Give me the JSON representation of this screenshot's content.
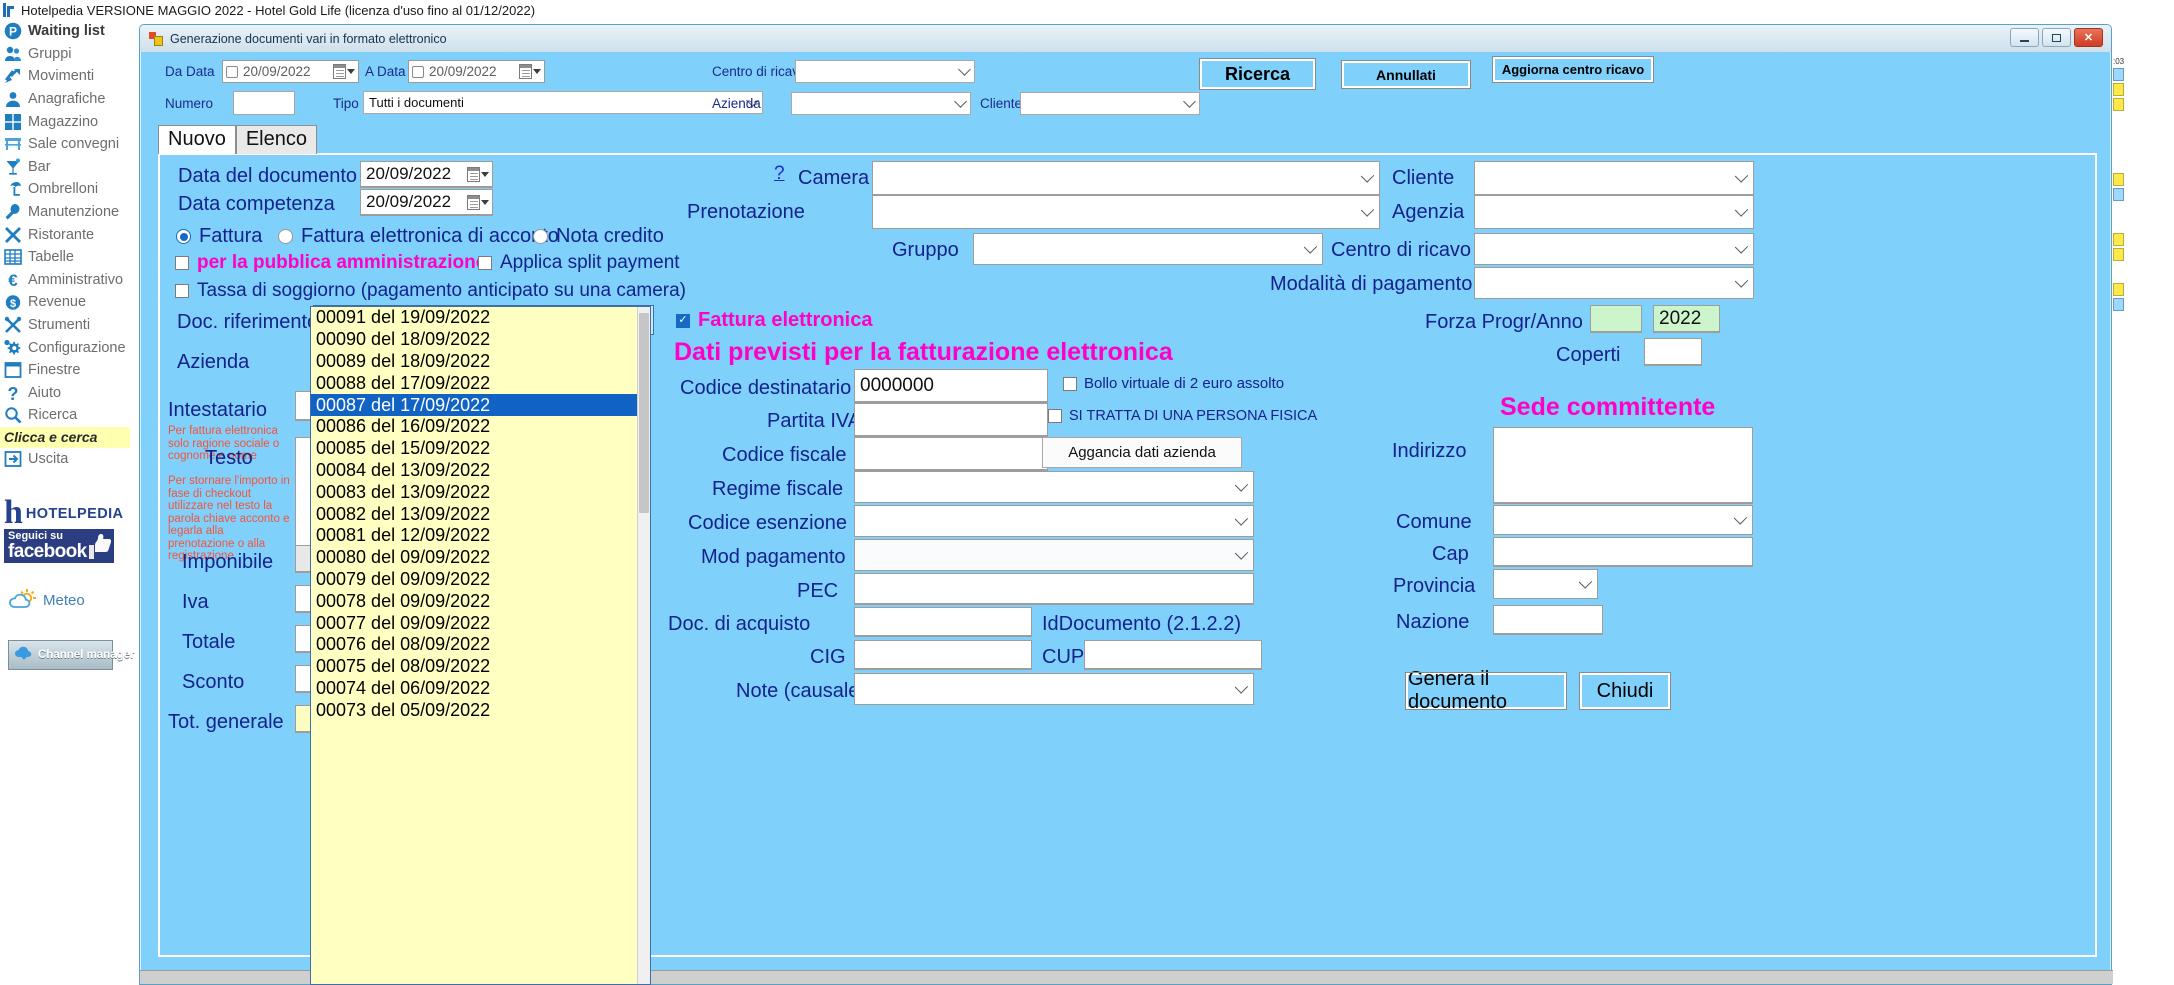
{
  "app": {
    "title": "Hotelpedia VERSIONE MAGGIO 2022 - Hotel Gold Life (licenza d'uso fino al 01/12/2022)",
    "logo_icon": "hotelpedia-logo-icon"
  },
  "sidebar": {
    "items": [
      {
        "label": "Waiting list",
        "icon": "parking-p-icon",
        "active": true
      },
      {
        "label": "Gruppi",
        "icon": "people-group-icon",
        "active": false
      },
      {
        "label": "Movimenti",
        "icon": "arrows-movement-icon",
        "active": false
      },
      {
        "label": "Anagrafiche",
        "icon": "person-card-icon",
        "active": false
      },
      {
        "label": "Magazzino",
        "icon": "boxes-warehouse-icon",
        "active": false
      },
      {
        "label": "Sale convegni",
        "icon": "conference-table-icon",
        "active": false
      },
      {
        "label": "Bar",
        "icon": "cocktail-glass-icon",
        "active": false
      },
      {
        "label": "Ombrelloni",
        "icon": "beach-umbrella-icon",
        "active": false
      },
      {
        "label": "Manutenzione",
        "icon": "wrench-icon",
        "active": false
      },
      {
        "label": "Ristorante",
        "icon": "fork-knife-icon",
        "active": false
      },
      {
        "label": "Tabelle",
        "icon": "table-grid-icon",
        "active": false
      },
      {
        "label": "Amministrativo",
        "icon": "euro-icon",
        "active": false
      },
      {
        "label": "Revenue",
        "icon": "dollar-coin-icon",
        "active": false
      },
      {
        "label": "Strumenti",
        "icon": "tools-icon",
        "active": false
      },
      {
        "label": "Configurazione",
        "icon": "gear-icon",
        "active": false
      },
      {
        "label": "Finestre",
        "icon": "window-icon",
        "active": false
      },
      {
        "label": "Aiuto",
        "icon": "question-mark-icon",
        "active": false
      },
      {
        "label": "Ricerca",
        "icon": "magnifier-icon",
        "active": false
      }
    ],
    "search_note": "Clicca e cerca",
    "exit": {
      "label": "Uscita",
      "icon": "exit-door-icon"
    },
    "brand": {
      "logo_letter": "h",
      "logo_word": "HOTELPEDIA",
      "facebook_line1": "Seguici su",
      "facebook_line2": "facebook",
      "facebook_icon": "thumbs-up-icon",
      "meteo_label": "Meteo",
      "meteo_icon": "sun-cloud-icon",
      "channel_manager_label": "Channel manager",
      "channel_manager_icon": "cloud-download-icon"
    }
  },
  "window": {
    "title": "Generazione documenti vari in formato elettronico",
    "icon": "visual-studio-form-icon",
    "buttons": {
      "minimize": "minimize-button",
      "maximize": "maximize-button",
      "close": "✕"
    }
  },
  "search_bar": {
    "da_data_label": "Da Data",
    "da_data_value": "20/09/2022",
    "a_data_label": "A Data",
    "a_data_value": "20/09/2022",
    "numero_label": "Numero",
    "numero_value": "",
    "tipo_label": "Tipo",
    "tipo_value": "Tutti i documenti",
    "centro_di_ricavo_label": "Centro di ricavo",
    "centro_di_ricavo_value": "",
    "azienda_label": "Azienda",
    "azienda_value": "",
    "cliente_label": "Cliente",
    "cliente_value": "",
    "ricerca_button": "Ricerca",
    "annullati_button": "Annullati",
    "aggiorna_button": "Aggiorna centro ricavo"
  },
  "tabs": [
    {
      "label": "Nuovo",
      "active": true
    },
    {
      "label": "Elenco",
      "active": false
    }
  ],
  "form": {
    "data_documento_label": "Data del documento",
    "data_documento_value": "20/09/2022",
    "data_competenza_label": "Data competenza",
    "data_competenza_value": "20/09/2022",
    "help_marker": "?",
    "camera_label": "Camera",
    "camera_value": "",
    "prenotazione_label": "Prenotazione",
    "prenotazione_value": "",
    "cliente_label": "Cliente",
    "cliente_value": "",
    "agenzia_label": "Agenzia",
    "agenzia_value": "",
    "gruppo_label": "Gruppo",
    "gruppo_value": "",
    "centro_ricavo_label": "Centro di ricavo",
    "centro_ricavo_value": "",
    "modalita_pagamento_label": "Modalità di pagamento",
    "modalita_pagamento_value": "",
    "doc_type_options": [
      {
        "label": "Fattura",
        "selected": true
      },
      {
        "label": "Fattura elettronica di acconto",
        "selected": false
      },
      {
        "label": "Nota credito",
        "selected": false
      }
    ],
    "pubblica_amministrazione_label": "per la pubblica amministrazione",
    "pubblica_amministrazione_checked": false,
    "split_payment_label": "Applica split payment",
    "split_payment_checked": false,
    "tassa_soggiorno_label": "Tassa di soggiorno (pagamento anticipato su una camera)",
    "tassa_soggiorno_checked": false,
    "doc_riferimento_label": "Doc. riferimento",
    "doc_riferimento_value": "",
    "azienda_label": "Azienda",
    "intestatario_label": "Intestatario",
    "intestatario_note": "Per fattura elettronica solo ragione sociale o cognome e nome",
    "testo_label": "Testo",
    "testo_note": "Per stornare l'importo in fase di checkout utilizzare nel testo la parola chiave acconto e legarla alla prenotazione o alla registrazione",
    "imponibile_label": "Imponibile",
    "iva_label": "Iva",
    "totale_label": "Totale",
    "sconto_label": "Sconto",
    "tot_generale_label": "Tot. generale"
  },
  "doc_dropdown": {
    "selected_index": 4,
    "items": [
      "00091 del 19/09/2022",
      "00090 del 18/09/2022",
      "00089 del 18/09/2022",
      "00088 del 17/09/2022",
      "00087 del 17/09/2022",
      "00086 del 16/09/2022",
      "00085 del 15/09/2022",
      "00084 del 13/09/2022",
      "00083 del 13/09/2022",
      "00082 del 13/09/2022",
      "00081 del 12/09/2022",
      "00080 del 09/09/2022",
      "00079 del 09/09/2022",
      "00078 del 09/09/2022",
      "00077 del 09/09/2022",
      "00076 del 08/09/2022",
      "00075 del 08/09/2022",
      "00074 del 06/09/2022",
      "00073 del 05/09/2022"
    ]
  },
  "einvoice": {
    "fattura_elettronica_label": "Fattura elettronica",
    "fattura_elettronica_checked": true,
    "section_title": "Dati previsti per la fatturazione elettronica",
    "codice_destinatario_label": "Codice destinatario",
    "codice_destinatario_value": "0000000",
    "bollo_label": "Bollo virtuale di 2 euro assolto",
    "bollo_checked": false,
    "partita_iva_label": "Partita IVA",
    "partita_iva_value": "",
    "persona_fisica_label": "SI TRATTA DI UNA PERSONA FISICA",
    "persona_fisica_checked": false,
    "codice_fiscale_label": "Codice fiscale",
    "codice_fiscale_value": "",
    "aggancia_button": "Aggancia dati azienda",
    "regime_fiscale_label": "Regime fiscale",
    "regime_fiscale_value": "",
    "codice_esenzione_label": "Codice esenzione",
    "codice_esenzione_value": "",
    "mod_pagamento_label": "Mod pagamento",
    "mod_pagamento_value": "",
    "pec_label": "PEC",
    "pec_value": "",
    "doc_acquisto_label": "Doc. di acquisto",
    "doc_acquisto_value": "",
    "iddocumento_label": "IdDocumento (2.1.2.2)",
    "cig_label": "CIG",
    "cig_value": "",
    "cup_label": "CUP",
    "cup_value": "",
    "note_causale_label": "Note (causale)",
    "note_causale_value": ""
  },
  "right_panel": {
    "forza_progr_label": "Forza Progr/Anno",
    "forza_progr_value": "",
    "anno_value": "2022",
    "coperti_label": "Coperti",
    "coperti_value": "",
    "sede_committente_title": "Sede committente",
    "indirizzo_label": "Indirizzo",
    "indirizzo_value": "",
    "comune_label": "Comune",
    "comune_value": "",
    "cap_label": "Cap",
    "cap_value": "",
    "provincia_label": "Provincia",
    "provincia_value": "",
    "nazione_label": "Nazione",
    "nazione_value": "",
    "genera_button": "Genera il documento",
    "chiudi_button": "Chiudi"
  },
  "colors": {
    "panel_blue": "#7fd0fb",
    "label_blue": "#14228c",
    "magenta": "#ff00c8",
    "dropdown_yellow": "#ffffc2",
    "selection_blue": "#1062c4",
    "note_red": "#f4543c",
    "green_field": "#ccf5cc"
  }
}
